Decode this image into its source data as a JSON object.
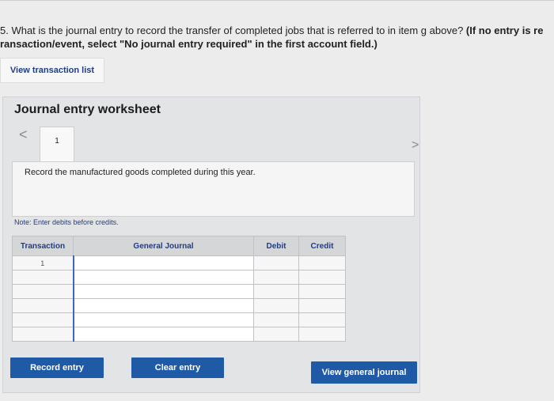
{
  "question": {
    "number": "5.",
    "text": " What is the journal entry to record the transfer of completed jobs that is referred to in item g above?",
    "hint_line1": " (If no entry is re",
    "line2": "ransaction/event, select \"No journal entry required\" in the first account field.)"
  },
  "view_transaction_list": "View transaction list",
  "worksheet": {
    "title": "Journal entry worksheet",
    "nav_prev": "<",
    "nav_next": ">",
    "tab": "1",
    "description": "Record the manufactured goods completed during this year.",
    "note": "Note: Enter debits before credits."
  },
  "table": {
    "headers": {
      "transaction": "Transaction",
      "general_journal": "General Journal",
      "debit": "Debit",
      "credit": "Credit"
    },
    "rows": [
      "1",
      "",
      "",
      "",
      "",
      ""
    ]
  },
  "buttons": {
    "record": "Record entry",
    "clear": "Clear entry",
    "view_general": "View general journal"
  },
  "colors": {
    "accent": "#1f5aa6",
    "link": "#1f3c88",
    "panel": "#e3e4e6"
  }
}
